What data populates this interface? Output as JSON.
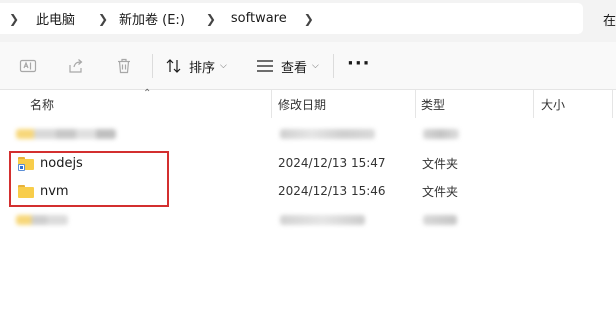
{
  "address_bar": {
    "crumbs": [
      "此电脑",
      "新加卷 (E:)",
      "software"
    ],
    "right_text": "在"
  },
  "toolbar": {
    "sort_label": "排序",
    "view_label": "查看",
    "more_label": "···"
  },
  "columns": {
    "name": "名称",
    "date": "修改日期",
    "type": "类型",
    "size": "大小"
  },
  "rows": [
    {
      "name": "nodejs",
      "date": "2024/12/13 15:47",
      "type": "文件夹",
      "shortcut": true
    },
    {
      "name": "nvm",
      "date": "2024/12/13 15:46",
      "type": "文件夹",
      "shortcut": false
    }
  ],
  "colors": {
    "highlight_border": "#d32f2f",
    "folder": "#f8cd4a"
  }
}
